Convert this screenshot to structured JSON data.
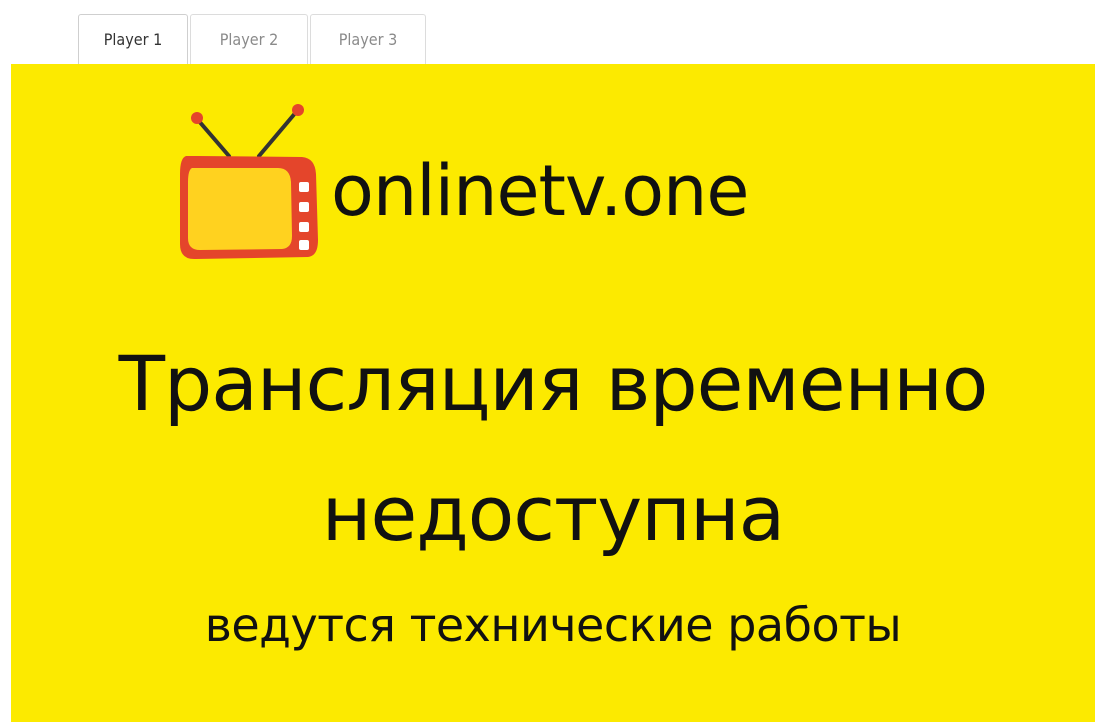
{
  "tabs": [
    {
      "label": "Player 1",
      "active": true
    },
    {
      "label": "Player 2",
      "active": false
    },
    {
      "label": "Player 3",
      "active": false
    }
  ],
  "player": {
    "background_color": "#fcea00",
    "logo_icon": "tv-icon",
    "brand": "onlinetv.one",
    "headline_line1": "Трансляция временно",
    "headline_line2": "недоступна",
    "subline": "ведутся технические работы"
  }
}
